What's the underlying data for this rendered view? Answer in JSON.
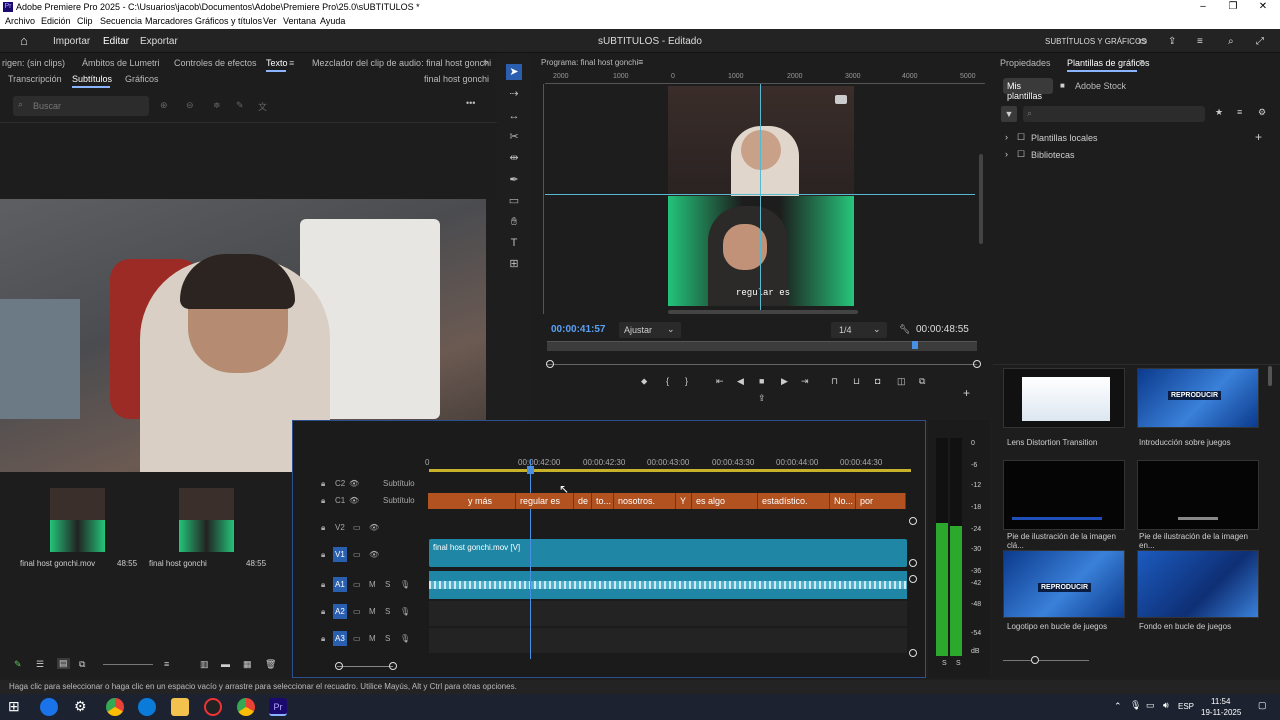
{
  "window": {
    "title": "Adobe Premiere Pro 2025 - C:\\Usuarios\\jacob\\Documentos\\Adobe\\Premiere Pro\\25.0\\sUBTITULOS *"
  },
  "menu": [
    "Archivo",
    "Edición",
    "Clip",
    "Secuencia",
    "Marcadores",
    "Gráficos y títulos",
    "Ver",
    "Ventana",
    "Ayuda"
  ],
  "header": {
    "import": "Importar",
    "edit": "Editar",
    "export": "Exportar",
    "project_title": "sUBTITULOS - Editado",
    "workspace": "SUBTÍTULOS Y GRÁFICOS"
  },
  "left_panel": {
    "tabs": [
      "rigen: (sin clips)",
      "Ámbitos de Lumetri",
      "Controles de efectos",
      "Texto",
      "Mezclador del clip de audio: final host gonchi"
    ],
    "subtabs": [
      "Transcripción",
      "Subtítulos",
      "Gráficos"
    ],
    "clip_name": "final host gonchi",
    "search_placeholder": "Buscar"
  },
  "program": {
    "title": "Programa: final host gonchi",
    "ruler": [
      "2000",
      "1000",
      "0",
      "1000",
      "2000",
      "3000",
      "4000",
      "5000"
    ],
    "caption": "regular es",
    "timecode": "00:00:41:57",
    "fit": "Ajustar",
    "quality": "1/4",
    "duration": "00:00:48:55"
  },
  "timeline": {
    "timecodes": [
      "00:00:42:00",
      "00:00:42:30",
      "00:00:43:00",
      "00:00:43:30",
      "00:00:44:00",
      "00:00:44:30"
    ],
    "tracks": [
      {
        "id": "C2",
        "name": "Subtítulo"
      },
      {
        "id": "C1",
        "name": "Subtítulo"
      },
      {
        "id": "V2",
        "name": ""
      },
      {
        "id": "V1",
        "name": ""
      },
      {
        "id": "A1",
        "name": ""
      },
      {
        "id": "A2",
        "name": ""
      },
      {
        "id": "A3",
        "name": ""
      }
    ],
    "captions": [
      "y más",
      "regular es",
      "de",
      "to...",
      "nosotros.",
      "Y",
      "es algo",
      "estadístico.",
      "No...",
      "por"
    ],
    "video_clip": "final host gonchi.mov [V]"
  },
  "project_bin": [
    {
      "name": "final host gonchi.mov",
      "duration": "48:55"
    },
    {
      "name": "final host gonchi",
      "duration": "48:55"
    }
  ],
  "meter_labels": [
    "0",
    "-6",
    "-12",
    "-18",
    "-24",
    "-30",
    "-36",
    "-42",
    "-48",
    "-54",
    "dB"
  ],
  "meter_solo": [
    "S",
    "S"
  ],
  "right_panel": {
    "tabs": [
      "Propiedades",
      "Plantillas de gráficos"
    ],
    "subtabs": [
      "Mis plantillas",
      "Adobe Stock"
    ],
    "tree": [
      "Plantillas locales",
      "Bibliotecas"
    ],
    "templates": [
      "Lens Distortion Transition",
      "Introducción sobre juegos",
      "Pie de ilustración de la imagen clá...",
      "Pie de ilustración de la imagen en...",
      "Logotipo en bucle de juegos",
      "Fondo en bucle de juegos"
    ],
    "thumb_text": "REPRODUCIR"
  },
  "status": "Haga clic para seleccionar o haga clic en un espacio vacío y arrastre para seleccionar el recuadro. Utilice Mayús, Alt y Ctrl para otras opciones.",
  "taskbar": {
    "lang": "ESP",
    "time": "11:54",
    "date": "19-11-2025"
  },
  "colors": {
    "accent": "#4a90e2",
    "caption_clip": "#b25220",
    "video_clip": "#1f87a5",
    "audio_clip": "#1f87a5",
    "meter": "#2ca92c"
  }
}
